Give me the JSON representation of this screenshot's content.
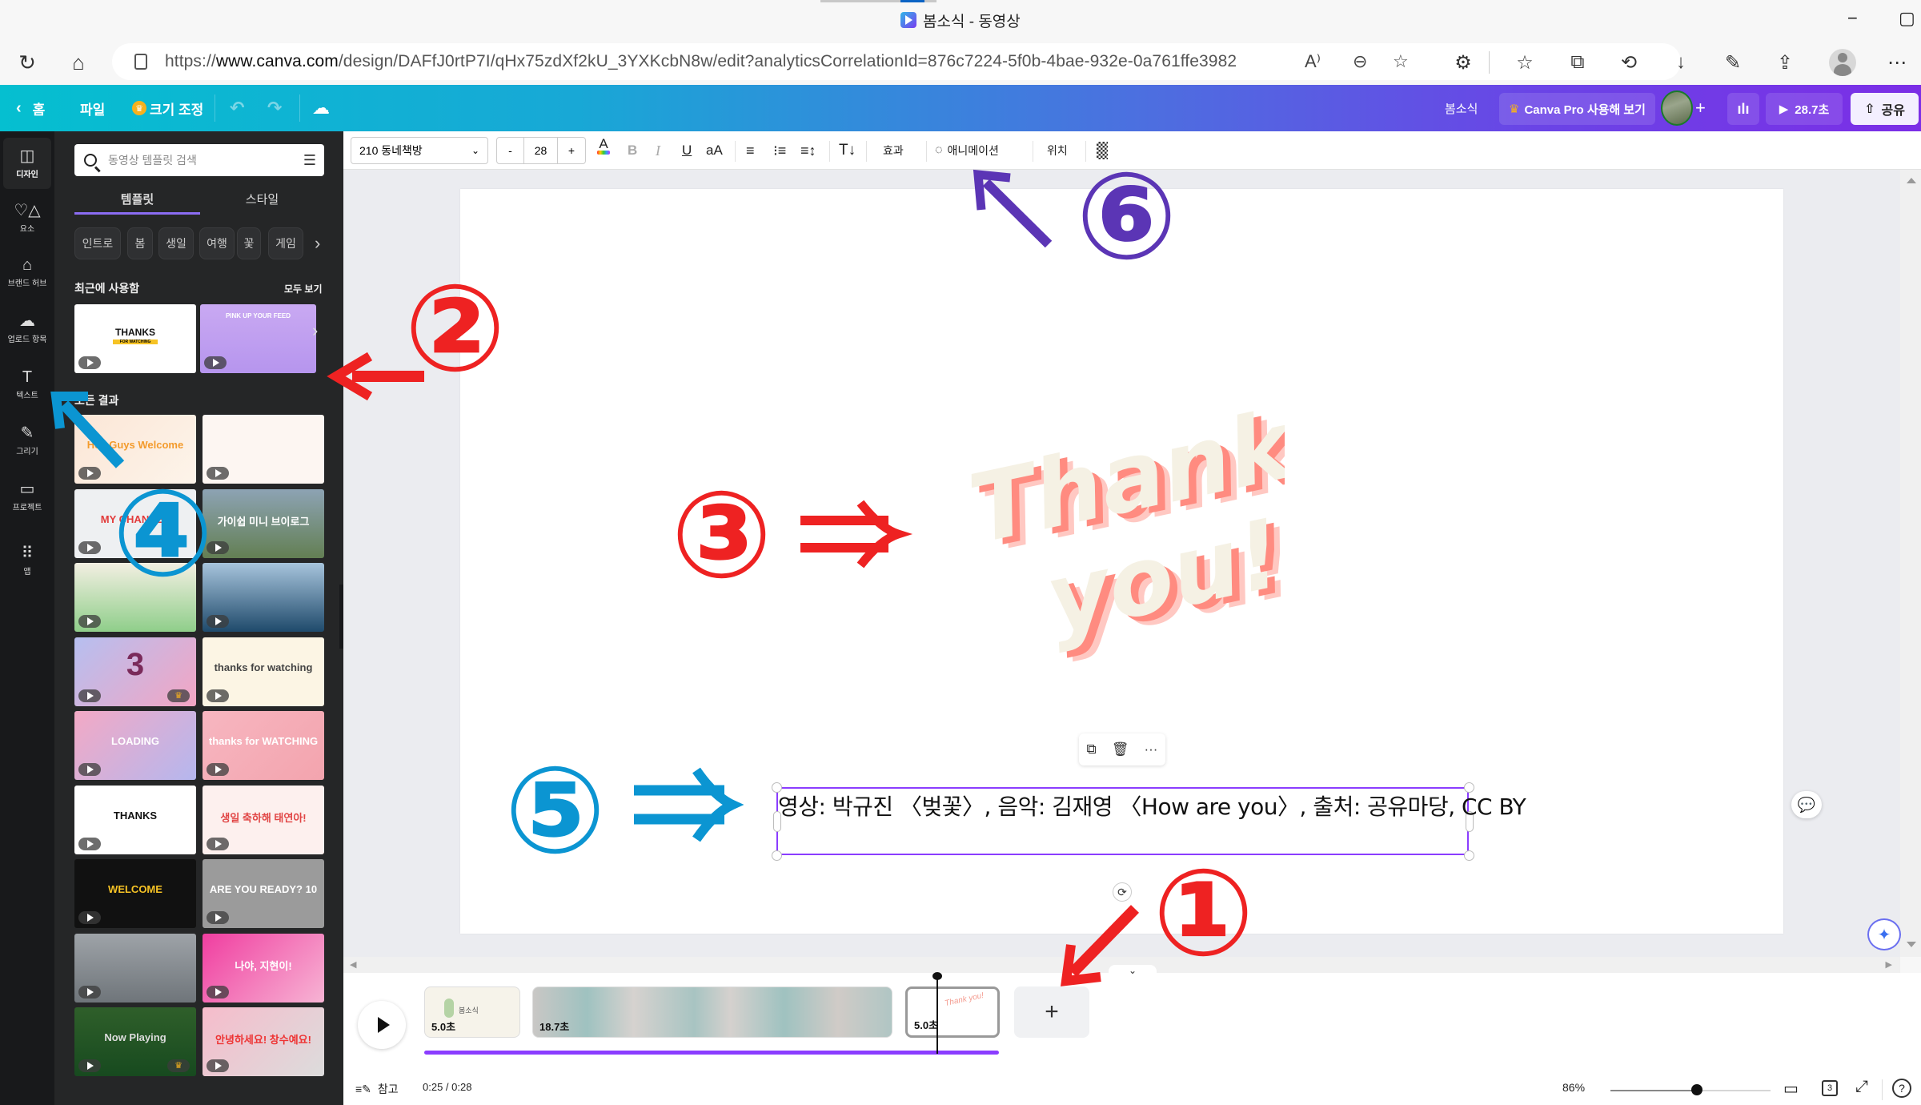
{
  "browser": {
    "tab_title": "봄소식 - 동영상",
    "url_prefix": "https://",
    "url_domain": "www.canva.com",
    "url_path": "/design/DAFfJ0rtP7I/qHx75zdXf2kU_3YXKcbN8w/edit?analyticsCorrelationId=876c7224-5f0b-4bae-932e-0a761ffe3982",
    "window_minimize": "−",
    "window_restore": "▢",
    "more": "⋯"
  },
  "header": {
    "home": "홈",
    "file": "파일",
    "resize": "크기 조정",
    "project_name": "봄소식",
    "pro_trial": "Canva Pro 사용해 보기",
    "duration": "28.7초",
    "share": "공유"
  },
  "rail": [
    {
      "label": "디자인",
      "icon": "layout-icon",
      "glyph": "◫",
      "active": true
    },
    {
      "label": "요소",
      "icon": "elements-icon",
      "glyph": "♡△",
      "active": false
    },
    {
      "label": "브랜드 허브",
      "icon": "brand-icon",
      "glyph": "⌂",
      "active": false
    },
    {
      "label": "업로드 항목",
      "icon": "upload-icon",
      "glyph": "☁",
      "active": false
    },
    {
      "label": "텍스트",
      "icon": "text-icon",
      "glyph": "T",
      "active": false
    },
    {
      "label": "그리기",
      "icon": "draw-icon",
      "glyph": "✎",
      "active": false
    },
    {
      "label": "프로젝트",
      "icon": "folder-icon",
      "glyph": "▭",
      "active": false
    },
    {
      "label": "앱",
      "icon": "apps-icon",
      "glyph": "⠿",
      "active": false
    }
  ],
  "panel": {
    "search_placeholder": "동영상 템플릿 검색",
    "tabs": [
      "템플릿",
      "스타일"
    ],
    "chips": [
      "인트로",
      "봄",
      "생일",
      "여행",
      "꽃",
      "게임"
    ],
    "recent_title": "최근에 사용함",
    "see_all": "모두 보기",
    "all_results_title": "모든 결과",
    "recent": [
      {
        "label": "THANKS",
        "sub": "FOR WATCHING"
      },
      {
        "label": "PINK UP YOUR FEED",
        "sub": ""
      }
    ],
    "results": [
      {
        "label": "Hey Guys Welcome",
        "pro": false
      },
      {
        "label": "",
        "pro": false
      },
      {
        "label": "MY CHANNEL",
        "pro": false
      },
      {
        "label": "가이쉽 미니 브이로그",
        "pro": false
      },
      {
        "label": "",
        "pro": false
      },
      {
        "label": "",
        "pro": false
      },
      {
        "label": "3",
        "pro": true
      },
      {
        "label": "thanks for watching",
        "pro": false
      },
      {
        "label": "LOADING",
        "pro": false
      },
      {
        "label": "thanks for WATCHING",
        "pro": false
      },
      {
        "label": "THANKS",
        "pro": false
      },
      {
        "label": "생일 축하해 태연아!",
        "pro": false
      },
      {
        "label": "WELCOME",
        "pro": false
      },
      {
        "label": "ARE YOU READY? 10",
        "pro": false
      },
      {
        "label": "",
        "pro": false
      },
      {
        "label": "나야, 지현이!",
        "pro": false
      },
      {
        "label": "Now Playing",
        "pro": true
      },
      {
        "label": "안녕하세요! 창수예요!",
        "pro": false
      }
    ]
  },
  "toolbar": {
    "font": "210 동네책방",
    "font_size": "28",
    "minus": "-",
    "plus": "+",
    "bold": "B",
    "italic": "I",
    "underline": "U",
    "case": "aA",
    "effects": "효과",
    "animate": "애니메이션",
    "position": "위치"
  },
  "canvas": {
    "headline_line1": "Thank",
    "headline_line2": "you!",
    "caption": "영상: 박규진 〈벚꽃〉,  음악: 김재영 〈How are you〉,  출처: 공유마당, CC BY"
  },
  "timeline": {
    "clips": [
      {
        "duration": "5.0초",
        "label": "봄소식"
      },
      {
        "duration": "18.7초",
        "label": ""
      },
      {
        "duration": "5.0초",
        "label": "Thank you!"
      }
    ],
    "add": "+",
    "notes": "참고",
    "time": "0:25 / 0:28",
    "zoom": "86%",
    "zoom_value": 0.54,
    "pages": "3",
    "progress": 0.89
  },
  "annotations": {
    "one": "①",
    "two": "②",
    "three": "③",
    "four": "④",
    "five": "⑤",
    "six": "⑥",
    "red": "#ee2222",
    "blue": "#0b95d2",
    "purple": "#5b35b5"
  }
}
